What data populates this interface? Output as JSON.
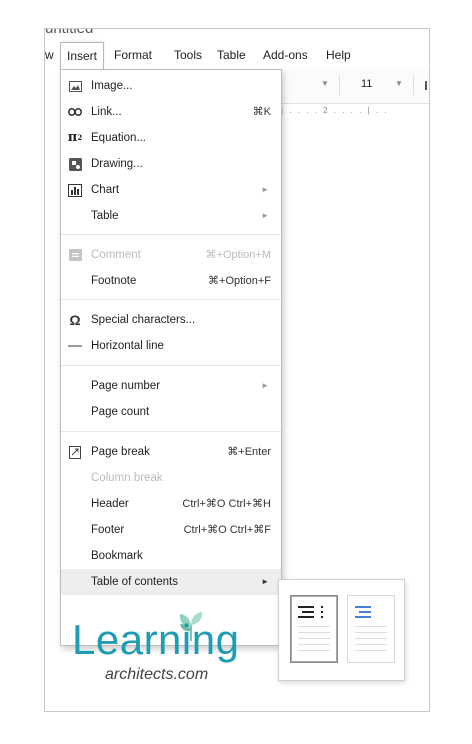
{
  "app": {
    "title_stub": "untitled"
  },
  "menubar": {
    "items": [
      "w",
      "Insert",
      "Format",
      "Tools",
      "Table",
      "Add-ons",
      "Help"
    ]
  },
  "toolbar": {
    "font_size": "11"
  },
  "ruler": {
    "text": "| . . . . 2 . . . . | . ."
  },
  "insert_menu": {
    "items": [
      {
        "label": "Image...",
        "icon": "image-icon"
      },
      {
        "label": "Link...",
        "shortcut": "⌘K",
        "icon": "link-icon"
      },
      {
        "label": "Equation...",
        "icon": "equation-icon"
      },
      {
        "label": "Drawing...",
        "icon": "drawing-icon"
      },
      {
        "label": "Chart",
        "icon": "chart-icon",
        "submenu": true
      },
      {
        "label": "Table",
        "submenu": true
      },
      {
        "label": "Comment",
        "shortcut": "⌘+Option+M",
        "icon": "comment-icon",
        "disabled": true
      },
      {
        "label": "Footnote",
        "shortcut": "⌘+Option+F"
      },
      {
        "label": "Special characters...",
        "icon": "omega-icon"
      },
      {
        "label": "Horizontal line",
        "icon": "horizontal-line-icon"
      },
      {
        "label": "Page number",
        "submenu": true
      },
      {
        "label": "Page count"
      },
      {
        "label": "Page break",
        "shortcut": "⌘+Enter",
        "icon": "page-break-icon"
      },
      {
        "label": "Column break",
        "disabled": true
      },
      {
        "label": "Header",
        "shortcut": "Ctrl+⌘O Ctrl+⌘H"
      },
      {
        "label": "Footer",
        "shortcut": "Ctrl+⌘O Ctrl+⌘F"
      },
      {
        "label": "Bookmark"
      },
      {
        "label": "Table of contents",
        "submenu": true,
        "highlighted": true
      }
    ]
  },
  "toc_submenu": {
    "options": [
      "toc-with-page-numbers-icon",
      "toc-with-blue-links-icon"
    ]
  },
  "logo": {
    "word": "Learning",
    "sub": "architects.com",
    "color": "#1e9cb4"
  },
  "colors": {
    "accent_blue": "#4a7fd6",
    "menu_highlight": "#eeeeee",
    "disabled_text": "#bbbbbb"
  }
}
